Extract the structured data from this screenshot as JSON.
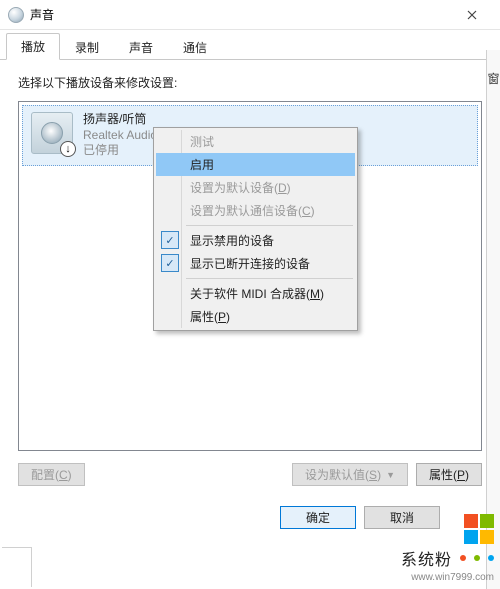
{
  "window": {
    "title": "声音"
  },
  "tabs": [
    {
      "label": "播放",
      "active": true
    },
    {
      "label": "录制",
      "active": false
    },
    {
      "label": "声音",
      "active": false
    },
    {
      "label": "通信",
      "active": false
    }
  ],
  "instruction": "选择以下播放设备来修改设置:",
  "device": {
    "name": "扬声器/听筒",
    "driver": "Realtek Audio",
    "status": "已停用"
  },
  "context_menu": {
    "items": [
      {
        "label": "测试",
        "disabled": true
      },
      {
        "label": "启用",
        "highlight": true
      },
      {
        "label": "设置为默认设备(",
        "mnemonic": "D",
        "tail": ")",
        "disabled": true
      },
      {
        "label": "设置为默认通信设备(",
        "mnemonic": "C",
        "tail": ")",
        "disabled": true
      },
      {
        "sep": true
      },
      {
        "label": "显示禁用的设备",
        "checked": true
      },
      {
        "label": "显示已断开连接的设备",
        "checked": true
      },
      {
        "sep": true
      },
      {
        "label": "关于软件 MIDI 合成器(",
        "mnemonic": "M",
        "tail": ")"
      },
      {
        "label": "属性(",
        "mnemonic": "P",
        "tail": ")"
      }
    ]
  },
  "buttons": {
    "configure": "配置(",
    "configure_mn": "C",
    "configure_tail": ")",
    "set_default": "设为默认值(",
    "set_default_mn": "S",
    "set_default_tail": ")",
    "properties": "属性(",
    "properties_mn": "P",
    "properties_tail": ")",
    "ok": "确定",
    "cancel": "取消"
  },
  "external": {
    "right_char": "窗"
  },
  "brand": {
    "text": "系统粉",
    "url": "www.win7999.com"
  }
}
